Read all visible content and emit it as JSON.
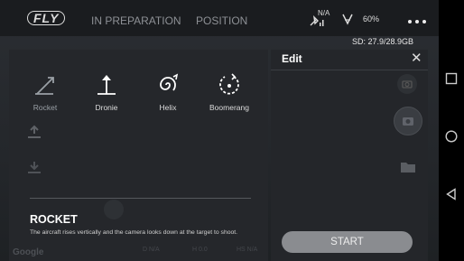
{
  "topbar": {
    "logo": "FLY",
    "status_title": "IN PREPARATION",
    "position_label": "POSITION",
    "gps_text": "N/A",
    "battery_percent": "60%",
    "more_icon": "more-dots-icon"
  },
  "storage": {
    "sd_label": "SD: 27.9/28.9GB"
  },
  "modes": [
    {
      "label": "Rocket",
      "icon": "rocket-icon"
    },
    {
      "label": "Dronie",
      "icon": "dronie-icon"
    },
    {
      "label": "Helix",
      "icon": "helix-icon"
    },
    {
      "label": "Boomerang",
      "icon": "boomerang-icon"
    }
  ],
  "description": {
    "title": "ROCKET",
    "text": "The aircraft rises vertically and the camera looks down at the target to shoot."
  },
  "edit_panel": {
    "title": "Edit",
    "start_label": "START"
  },
  "bottom": {
    "google": "Google",
    "d_label": "D N/A",
    "h_label": "H 0.0",
    "hs_label": "HS N/A"
  },
  "colors": {
    "background": "#1f2226",
    "panel": "#25272b",
    "start_button": "#8a8c90"
  }
}
